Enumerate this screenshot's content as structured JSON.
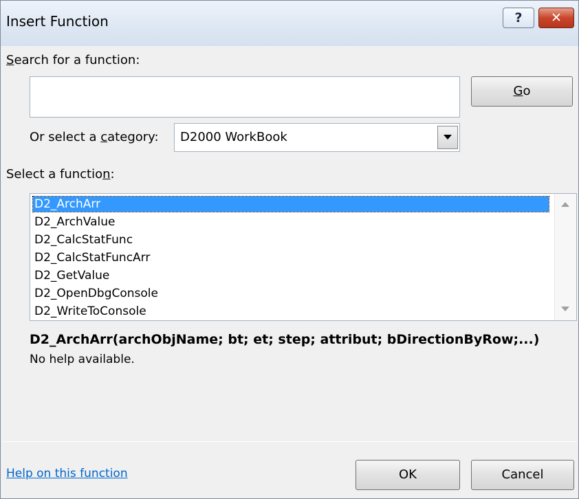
{
  "window": {
    "title": "Insert Function",
    "help_glyph": "?",
    "close_glyph": "✕"
  },
  "search": {
    "label_mnemonic": "S",
    "label_rest": "earch for a function:",
    "value": "",
    "go_mnemonic": "G",
    "go_rest": "o"
  },
  "category": {
    "label_before": "Or select a ",
    "label_mnemonic": "c",
    "label_after": "ategory:",
    "selected": "D2000 WorkBook"
  },
  "functions": {
    "label_before": "Select a functio",
    "label_mnemonic": "n",
    "label_after": ":",
    "items": [
      "D2_ArchArr",
      "D2_ArchValue",
      "D2_CalcStatFunc",
      "D2_CalcStatFuncArr",
      "D2_GetValue",
      "D2_OpenDbgConsole",
      "D2_WriteToConsole"
    ],
    "selected_index": 0
  },
  "details": {
    "signature": "D2_ArchArr(archObjName; bt; et; step; attribut; bDirectionByRow;...)",
    "description": "No help available."
  },
  "footer": {
    "help_link": "Help on this function",
    "ok": "OK",
    "cancel": "Cancel"
  }
}
